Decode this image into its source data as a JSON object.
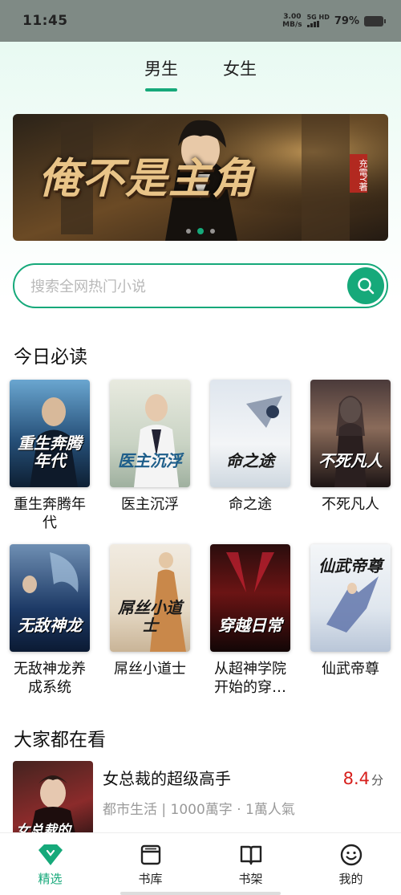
{
  "status": {
    "time": "11:45",
    "speed_value": "3.00",
    "speed_unit": "MB/s",
    "signal": "5G HD",
    "battery": "79%"
  },
  "tabs": [
    {
      "label": "男生",
      "active": true
    },
    {
      "label": "女生",
      "active": false
    }
  ],
  "banner": {
    "title": "俺不是主角",
    "author": "充電Y著",
    "slide_count": 3,
    "active_slide": 2
  },
  "search": {
    "placeholder": "搜索全网热门小说",
    "icon": "search-icon"
  },
  "today": {
    "title": "今日必读",
    "books": [
      {
        "name": "重生奔腾年代",
        "cover_text": "重生奔腾年代"
      },
      {
        "name": "医主沉浮",
        "cover_text": "医主沉浮"
      },
      {
        "name": "命之途",
        "cover_text": "命之途"
      },
      {
        "name": "不死凡人",
        "cover_text": "不死凡人"
      },
      {
        "name": "无敌神龙养成系统",
        "cover_text": "无敌神龙"
      },
      {
        "name": "屌丝小道士",
        "cover_text": "屌丝小道士"
      },
      {
        "name": "从超神学院开始的穿越日常",
        "cover_text": "穿越日常"
      },
      {
        "name": "仙武帝尊",
        "cover_text": "仙武帝尊"
      }
    ]
  },
  "popular": {
    "title": "大家都在看",
    "items": [
      {
        "title": "女总裁的超级高手",
        "meta": "都市生活 | 1000萬字 · 1萬人氣",
        "score": "8.4",
        "score_unit": "分",
        "cover_text": "女总裁的"
      }
    ]
  },
  "nav": [
    {
      "label": "精选",
      "icon": "diamond-icon",
      "active": true
    },
    {
      "label": "书库",
      "icon": "library-icon",
      "active": false
    },
    {
      "label": "书架",
      "icon": "bookshelf-icon",
      "active": false
    },
    {
      "label": "我的",
      "icon": "profile-smile-icon",
      "active": false
    }
  ],
  "colors": {
    "accent": "#16a97a",
    "score": "#d7201d",
    "status_bar": "#7f8a85"
  }
}
